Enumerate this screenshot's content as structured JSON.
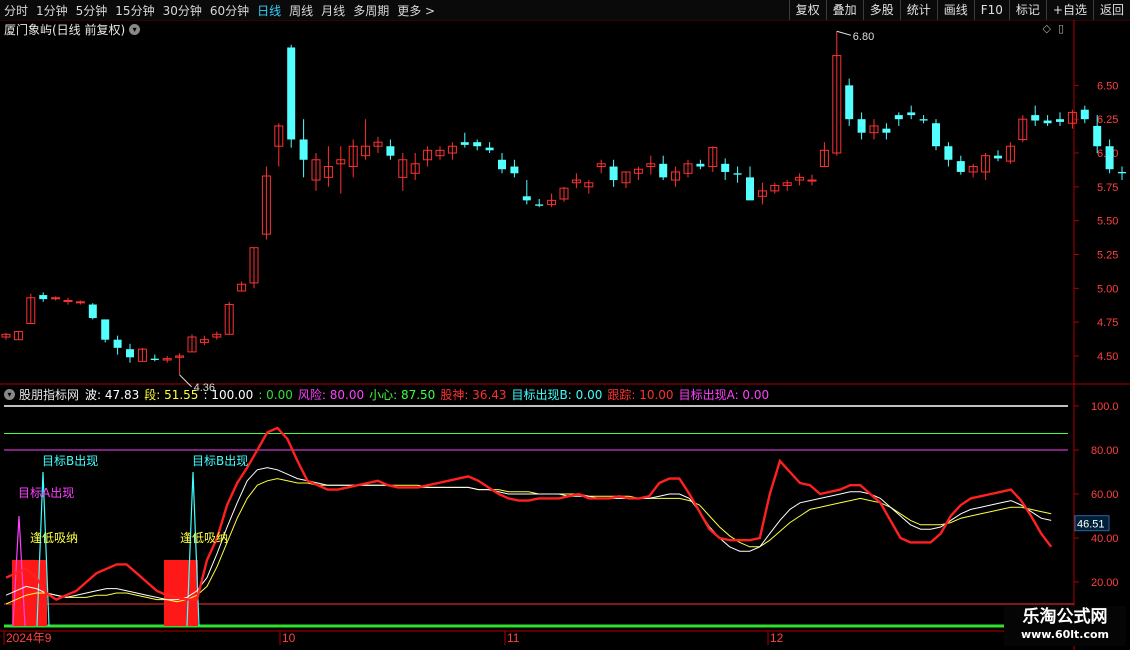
{
  "toolbar": {
    "periods": [
      "分时",
      "1分钟",
      "5分钟",
      "15分钟",
      "30分钟",
      "60分钟",
      "日线",
      "周线",
      "月线",
      "多周期",
      "更多 >"
    ],
    "active_period": "日线",
    "right_buttons": [
      "复权",
      "叠加",
      "多股",
      "统计",
      "画线",
      "F10",
      "标记",
      "+自选",
      "返回"
    ]
  },
  "main": {
    "title": "厦门象屿(日线 前复权)",
    "yaxis_ticks": [
      "6.50",
      "6.25",
      "6.00",
      "5.75",
      "5.50",
      "5.25",
      "5.00",
      "4.75",
      "4.50"
    ],
    "high_label": "6.80",
    "low_label": "4.36"
  },
  "indicator": {
    "name": "股朋指标网",
    "items": [
      {
        "text": "波: 47.83",
        "color": "#ffffff"
      },
      {
        "text": "段: 51.55",
        "color": "#ffff40"
      },
      {
        "text": ": 100.00",
        "color": "#ffffff"
      },
      {
        "text": ": 0.00",
        "color": "#34e034"
      },
      {
        "text": "风险: 80.00",
        "color": "#ff40ff"
      },
      {
        "text": "小心: 87.50",
        "color": "#40ff40"
      },
      {
        "text": "股神: 36.43",
        "color": "#ff3030"
      },
      {
        "text": "目标出现B: 0.00",
        "color": "#40ffff"
      },
      {
        "text": "跟踪: 10.00",
        "color": "#ff3030"
      },
      {
        "text": "目标出现A: 0.00",
        "color": "#ff40ff"
      }
    ],
    "yaxis_ticks": [
      "100.0",
      "80.00",
      "60.00",
      "40.00",
      "20.00"
    ],
    "current_value": "46.51",
    "annotations": {
      "target_b": "目标B出现",
      "target_a": "目标A出现",
      "low_absorb": "逢低吸纳"
    }
  },
  "date_axis": [
    "2024年9",
    "10",
    "11",
    "12"
  ],
  "watermark": {
    "line1": "乐淘公式网",
    "line2": "www.60lt.com"
  },
  "colors": {
    "up": "#ff3232",
    "down": "#54ffff",
    "axis": "#b00000",
    "label": "#ff4040"
  },
  "chart_data": {
    "type": "candlestick",
    "ylim": [
      4.3,
      6.85
    ],
    "candles": [
      [
        4.64,
        4.67,
        4.62,
        4.66
      ],
      [
        4.62,
        4.68,
        4.62,
        4.68
      ],
      [
        4.74,
        4.96,
        4.74,
        4.93
      ],
      [
        4.95,
        4.97,
        4.9,
        4.92
      ],
      [
        4.93,
        4.94,
        4.91,
        4.93
      ],
      [
        4.91,
        4.93,
        4.88,
        4.91
      ],
      [
        4.9,
        4.91,
        4.88,
        4.9
      ],
      [
        4.88,
        4.89,
        4.77,
        4.78
      ],
      [
        4.77,
        4.77,
        4.6,
        4.62
      ],
      [
        4.62,
        4.65,
        4.51,
        4.56
      ],
      [
        4.55,
        4.59,
        4.45,
        4.49
      ],
      [
        4.46,
        4.56,
        4.46,
        4.55
      ],
      [
        4.48,
        4.51,
        4.46,
        4.47
      ],
      [
        4.47,
        4.5,
        4.45,
        4.48
      ],
      [
        4.49,
        4.52,
        4.36,
        4.5
      ],
      [
        4.53,
        4.66,
        4.53,
        4.64
      ],
      [
        4.6,
        4.65,
        4.58,
        4.62
      ],
      [
        4.64,
        4.68,
        4.62,
        4.66
      ],
      [
        4.66,
        4.9,
        4.66,
        4.88
      ],
      [
        4.98,
        5.05,
        4.98,
        5.03
      ],
      [
        5.04,
        5.3,
        5.0,
        5.3
      ],
      [
        5.4,
        5.9,
        5.36,
        5.83
      ],
      [
        6.05,
        6.22,
        5.9,
        6.2
      ],
      [
        6.78,
        6.8,
        6.04,
        6.1
      ],
      [
        6.1,
        6.25,
        5.82,
        5.95
      ],
      [
        5.8,
        6.0,
        5.72,
        5.95
      ],
      [
        5.82,
        6.05,
        5.75,
        5.9
      ],
      [
        5.92,
        6.05,
        5.7,
        5.95
      ],
      [
        5.9,
        6.1,
        5.82,
        6.05
      ],
      [
        5.98,
        6.25,
        5.95,
        6.05
      ],
      [
        6.05,
        6.12,
        6.0,
        6.08
      ],
      [
        6.05,
        6.1,
        5.95,
        5.98
      ],
      [
        5.82,
        6.0,
        5.72,
        5.95
      ],
      [
        5.85,
        6.0,
        5.8,
        5.92
      ],
      [
        5.95,
        6.05,
        5.9,
        6.02
      ],
      [
        5.98,
        6.05,
        5.95,
        6.02
      ],
      [
        6.0,
        6.08,
        5.95,
        6.05
      ],
      [
        6.08,
        6.15,
        6.04,
        6.06
      ],
      [
        6.08,
        6.1,
        6.02,
        6.05
      ],
      [
        6.04,
        6.08,
        6.0,
        6.02
      ],
      [
        5.95,
        6.0,
        5.85,
        5.88
      ],
      [
        5.9,
        5.95,
        5.82,
        5.85
      ],
      [
        5.68,
        5.8,
        5.62,
        5.65
      ],
      [
        5.62,
        5.66,
        5.6,
        5.61
      ],
      [
        5.62,
        5.7,
        5.6,
        5.65
      ],
      [
        5.66,
        5.75,
        5.64,
        5.74
      ],
      [
        5.78,
        5.85,
        5.74,
        5.8
      ],
      [
        5.75,
        5.8,
        5.7,
        5.78
      ],
      [
        5.9,
        5.95,
        5.85,
        5.92
      ],
      [
        5.9,
        5.95,
        5.75,
        5.8
      ],
      [
        5.78,
        5.86,
        5.74,
        5.86
      ],
      [
        5.85,
        5.9,
        5.8,
        5.88
      ],
      [
        5.9,
        5.98,
        5.84,
        5.92
      ],
      [
        5.92,
        5.98,
        5.8,
        5.82
      ],
      [
        5.8,
        5.9,
        5.75,
        5.86
      ],
      [
        5.85,
        5.95,
        5.82,
        5.92
      ],
      [
        5.92,
        5.95,
        5.88,
        5.9
      ],
      [
        5.9,
        6.05,
        5.86,
        6.04
      ],
      [
        5.92,
        5.96,
        5.8,
        5.86
      ],
      [
        5.85,
        5.9,
        5.78,
        5.84
      ],
      [
        5.82,
        5.9,
        5.65,
        5.65
      ],
      [
        5.68,
        5.78,
        5.62,
        5.72
      ],
      [
        5.72,
        5.78,
        5.7,
        5.76
      ],
      [
        5.76,
        5.8,
        5.72,
        5.78
      ],
      [
        5.8,
        5.85,
        5.76,
        5.82
      ],
      [
        5.8,
        5.84,
        5.76,
        5.8
      ],
      [
        5.9,
        6.08,
        5.9,
        6.02
      ],
      [
        6.0,
        6.9,
        5.98,
        6.72
      ],
      [
        6.5,
        6.55,
        6.2,
        6.25
      ],
      [
        6.25,
        6.3,
        6.1,
        6.15
      ],
      [
        6.15,
        6.25,
        6.1,
        6.2
      ],
      [
        6.18,
        6.22,
        6.1,
        6.15
      ],
      [
        6.28,
        6.3,
        6.2,
        6.25
      ],
      [
        6.3,
        6.35,
        6.25,
        6.28
      ],
      [
        6.25,
        6.28,
        6.22,
        6.24
      ],
      [
        6.22,
        6.25,
        6.02,
        6.05
      ],
      [
        6.05,
        6.08,
        5.9,
        5.95
      ],
      [
        5.94,
        5.98,
        5.84,
        5.86
      ],
      [
        5.86,
        5.92,
        5.82,
        5.9
      ],
      [
        5.86,
        6.0,
        5.8,
        5.98
      ],
      [
        5.98,
        6.02,
        5.94,
        5.96
      ],
      [
        5.94,
        6.08,
        5.92,
        6.05
      ],
      [
        6.1,
        6.28,
        6.08,
        6.25
      ],
      [
        6.28,
        6.35,
        6.2,
        6.24
      ],
      [
        6.24,
        6.28,
        6.2,
        6.22
      ],
      [
        6.25,
        6.3,
        6.2,
        6.23
      ],
      [
        6.22,
        6.32,
        6.18,
        6.3
      ],
      [
        6.32,
        6.35,
        6.22,
        6.25
      ],
      [
        6.2,
        6.28,
        6.0,
        6.05
      ],
      [
        6.05,
        6.1,
        5.85,
        5.88
      ],
      [
        5.86,
        5.9,
        5.8,
        5.85
      ]
    ],
    "indicator_series": {
      "gushen": [
        22,
        24,
        26,
        22,
        15,
        12,
        14,
        16,
        20,
        24,
        26,
        28,
        28,
        24,
        20,
        16,
        14,
        13,
        12,
        12,
        30,
        40,
        55,
        65,
        72,
        80,
        88,
        90,
        85,
        75,
        66,
        64,
        62,
        62,
        63,
        64,
        65,
        66,
        64,
        63,
        63,
        63,
        64,
        65,
        66,
        67,
        68,
        66,
        63,
        60,
        58,
        57,
        57,
        58,
        58,
        58,
        59,
        60,
        58,
        58,
        58,
        59,
        58,
        58,
        59,
        65,
        67,
        67,
        60,
        52,
        44,
        40,
        39,
        39,
        39,
        40,
        60,
        75,
        70,
        65,
        64,
        60,
        61,
        62,
        64,
        64,
        60,
        56,
        48,
        40,
        38,
        38,
        38,
        42,
        50,
        55,
        58,
        59,
        60,
        61,
        62,
        57,
        50,
        42,
        36
      ],
      "bo": [
        14,
        16,
        18,
        17,
        15,
        14,
        13,
        14,
        15,
        16,
        17,
        17,
        16,
        15,
        14,
        13,
        12,
        12,
        13,
        16,
        22,
        33,
        45,
        56,
        66,
        71,
        72,
        71,
        69,
        67,
        66,
        65,
        64,
        64,
        64,
        64,
        64,
        64,
        64,
        63,
        63,
        63,
        63,
        63,
        63,
        63,
        63,
        62,
        62,
        61,
        60,
        60,
        60,
        60,
        60,
        60,
        59,
        59,
        59,
        58,
        58,
        58,
        58,
        58,
        58,
        59,
        60,
        60,
        58,
        52,
        45,
        40,
        36,
        34,
        34,
        36,
        42,
        48,
        53,
        56,
        57,
        58,
        59,
        60,
        61,
        61,
        60,
        58,
        54,
        50,
        46,
        44,
        44,
        45,
        48,
        51,
        53,
        54,
        55,
        56,
        57,
        55,
        52,
        49,
        48
      ],
      "duan": [
        10,
        12,
        14,
        15,
        15,
        14,
        13,
        13,
        13,
        14,
        14,
        15,
        15,
        14,
        13,
        12,
        12,
        11,
        12,
        14,
        18,
        27,
        38,
        49,
        58,
        64,
        66,
        67,
        66,
        65,
        65,
        64,
        64,
        64,
        64,
        64,
        64,
        64,
        64,
        64,
        64,
        64,
        63,
        63,
        63,
        63,
        63,
        62,
        62,
        62,
        61,
        61,
        61,
        60,
        60,
        60,
        60,
        60,
        59,
        59,
        59,
        59,
        59,
        58,
        58,
        58,
        58,
        58,
        57,
        55,
        50,
        45,
        41,
        38,
        36,
        36,
        39,
        43,
        47,
        50,
        53,
        54,
        55,
        56,
        57,
        58,
        57,
        56,
        54,
        51,
        48,
        46,
        46,
        46,
        47,
        49,
        50,
        51,
        52,
        53,
        54,
        54,
        53,
        52,
        51
      ]
    }
  }
}
